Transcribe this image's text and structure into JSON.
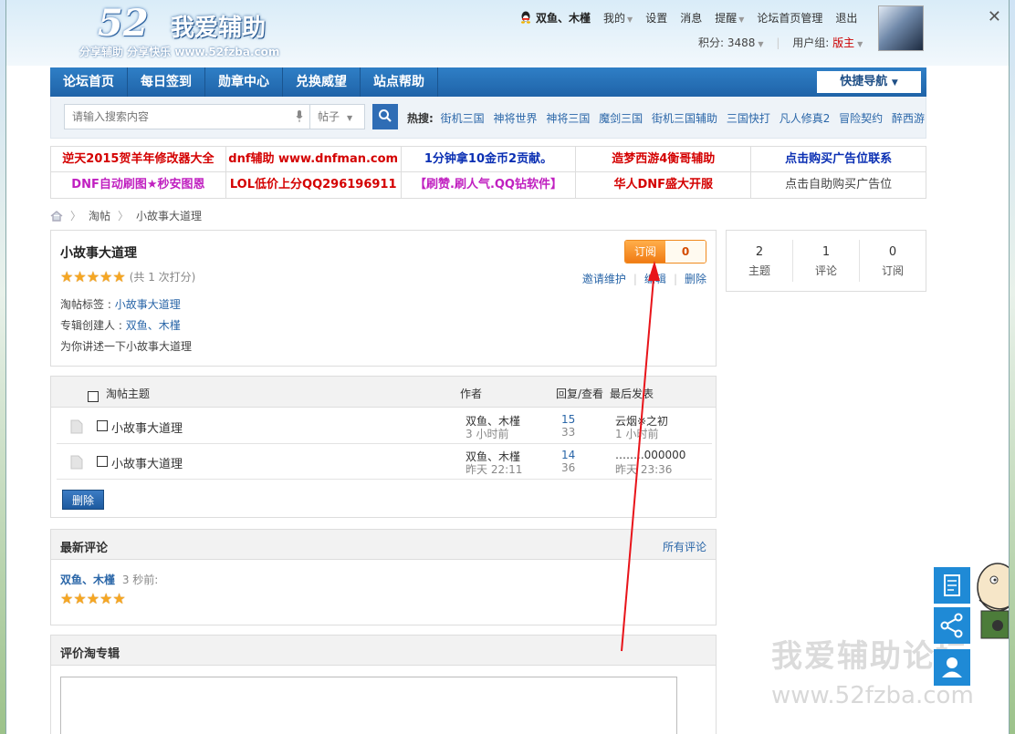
{
  "header": {
    "logo_num": "52",
    "logo_cn": "我爱辅助",
    "logo_slogan": "分享辅助  分享快乐  www.52fzba.com",
    "username": "双鱼、木槿",
    "links": [
      "我的",
      "设置",
      "消息",
      "提醒",
      "论坛首页管理",
      "退出"
    ],
    "points_label": "积分: 3488",
    "group_label": "用户组:",
    "group_value": "版主"
  },
  "nav": {
    "items": [
      "论坛首页",
      "每日签到",
      "勋章中心",
      "兑换威望",
      "站点帮助"
    ],
    "quick": "快捷导航"
  },
  "search": {
    "placeholder": "请输入搜索内容",
    "type": "帖子",
    "hot_label": "热搜:",
    "hot": [
      "街机三国",
      "神将世界",
      "神将三国",
      "魔剑三国",
      "街机三国辅助",
      "三国快打",
      "凡人修真2",
      "冒险契约",
      "醉西游"
    ]
  },
  "ads": {
    "row1": [
      "逆天2015贺羊年修改器大全",
      "dnf辅助 www.dnfman.com",
      "1分钟拿10金币2贡献。",
      "造梦西游4衡哥辅助",
      "点击购买广告位联系"
    ],
    "row2": [
      "DNF自动刷图★秒安图恩",
      "LOL低价上分QQ296196911",
      "【刷赞.刷人气.QQ钻软件】",
      "华人DNF盛大开服",
      "点击自助购买广告位"
    ],
    "row1_colors": [
      "#d40000",
      "#d40000",
      "#0a2fb3",
      "#d40000",
      "#0a2fb3"
    ],
    "row2_colors": [
      "#c020c0",
      "#d40000",
      "#c020c0",
      "#d40000",
      "#444444"
    ]
  },
  "breadcrumb": [
    "淘帖",
    "小故事大道理"
  ],
  "album": {
    "title": "小故事大道理",
    "rating": 5,
    "rating_count": "(共 1 次打分)",
    "tag_label": "淘帖标签 : ",
    "tag_value": "小故事大道理",
    "creator_label": "专辑创建人 : ",
    "creator_value": "双鱼、木槿",
    "desc": "为你讲述一下小故事大道理",
    "subscribe_label": "订阅",
    "subscribe_count": "0",
    "actions": [
      "邀请维护",
      "编辑",
      "删除"
    ]
  },
  "stats": [
    {
      "num": "2",
      "label": "主题"
    },
    {
      "num": "1",
      "label": "评论"
    },
    {
      "num": "0",
      "label": "订阅"
    }
  ],
  "threads": {
    "headers": {
      "topic": "淘帖主题",
      "author": "作者",
      "reply_view": "回复/查看",
      "last": "最后发表"
    },
    "rows": [
      {
        "title": "小故事大道理",
        "author": "双鱼、木槿",
        "author_time": "3 小时前",
        "replies": "15",
        "views": "33",
        "last_user": "云烟※之初",
        "last_time": "1 小时前"
      },
      {
        "title": "小故事大道理",
        "author": "双鱼、木槿",
        "author_time": "昨天 22:11",
        "replies": "14",
        "views": "36",
        "last_user": "……..000000",
        "last_time": "昨天 23:36"
      }
    ],
    "delete_label": "删除"
  },
  "comments": {
    "title": "最新评论",
    "all": "所有评论",
    "user": "双鱼、木槿",
    "ago": "3 秒前:",
    "rating": 5
  },
  "rate": {
    "title": "评价淘专辑"
  },
  "watermark": {
    "line1": "我爱辅助论坛",
    "line2": "www.52fzba.com"
  },
  "colors": {
    "nav_blue": "#1f63a8",
    "link_blue": "#2a66a8",
    "orange": "#f07b14",
    "red_arrow": "#e8141a"
  }
}
